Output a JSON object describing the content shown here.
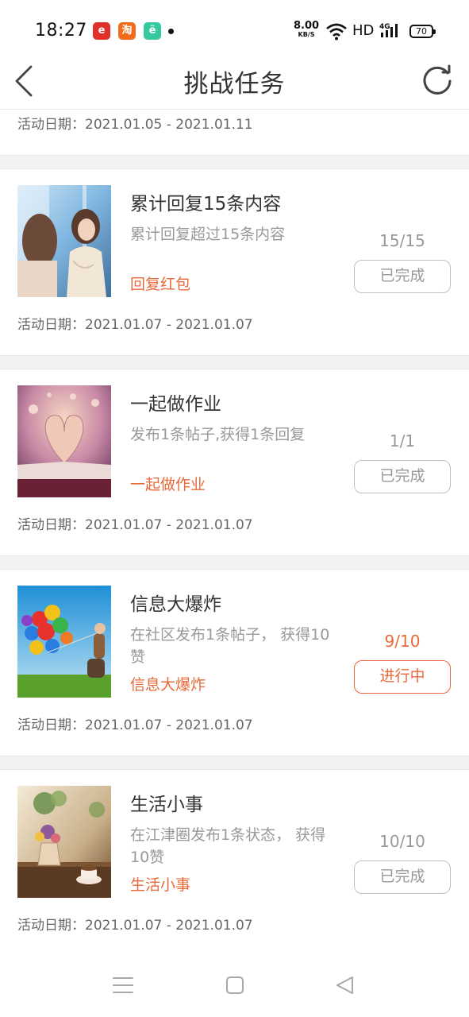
{
  "status_bar": {
    "time": "18:27",
    "net_speed_value": "8.00",
    "net_speed_unit": "KB/S",
    "hd_label": "HD",
    "battery": "70",
    "app_icons": [
      {
        "name": "e-app-icon",
        "glyph": "e",
        "color": "#e0302a"
      },
      {
        "name": "taobao-icon",
        "glyph": "淘",
        "color": "#f26a1b"
      },
      {
        "name": "assistant-app-icon",
        "glyph": "ё",
        "color": "#36c9a0"
      }
    ]
  },
  "header": {
    "title": "挑战任务",
    "back_icon": "chevron-left-icon",
    "refresh_icon": "refresh-icon"
  },
  "date_prefix": "活动日期：",
  "previous_card": {
    "date_range": "2021.01.05 - 2021.01.11"
  },
  "tasks": [
    {
      "name": "累计回复15条内容",
      "description": "累计回复超过15条内容",
      "reward": "回复红包",
      "progress": "15/15",
      "status": "已完成",
      "date_range": "2021.01.07 - 2021.01.07",
      "image": "two-girls-window-photo"
    },
    {
      "name": "一起做作业",
      "description": "发布1条帖子,获得1条回复",
      "reward": "一起做作业",
      "progress": "1/1",
      "status": "已完成",
      "date_range": "2021.01.07 - 2021.01.07",
      "image": "heart-book-photo"
    },
    {
      "name": "信息大爆炸",
      "description": "在社区发布1条帖子， 获得10赞",
      "reward": "信息大爆炸",
      "progress": "9/10",
      "status": "进行中",
      "date_range": "2021.01.07 - 2021.01.07",
      "image": "balloons-photo"
    },
    {
      "name": "生活小事",
      "description": "在江津圈发布1条状态， 获得10赞",
      "reward": "生活小事",
      "progress": "10/10",
      "status": "已完成",
      "date_range": "2021.01.07 - 2021.01.07",
      "image": "coffee-table-photo"
    }
  ],
  "colors": {
    "accent": "#e8693a",
    "muted": "#999999",
    "divider": "#f2f2f2"
  },
  "nav_bar": {
    "icons": [
      "menu-icon",
      "home-square-icon",
      "back-triangle-icon"
    ]
  }
}
